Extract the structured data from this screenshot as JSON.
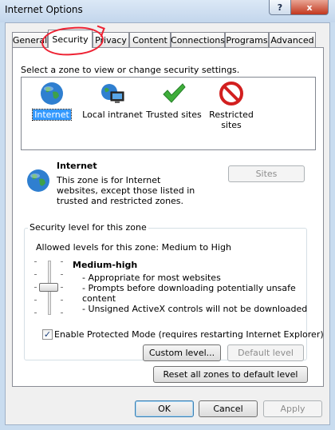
{
  "window": {
    "title": "Internet Options",
    "help_label": "?",
    "close_label": "x"
  },
  "tabs": [
    {
      "label": "General"
    },
    {
      "label": "Security",
      "active": true
    },
    {
      "label": "Privacy"
    },
    {
      "label": "Content"
    },
    {
      "label": "Connections"
    },
    {
      "label": "Programs"
    },
    {
      "label": "Advanced"
    }
  ],
  "zones": {
    "prompt": "Select a zone to view or change security settings.",
    "items": [
      {
        "label": "Internet",
        "icon": "globe-icon",
        "selected": true
      },
      {
        "label": "Local intranet",
        "icon": "intranet-icon"
      },
      {
        "label": "Trusted sites",
        "icon": "checkmark-icon"
      },
      {
        "label": "Restricted sites",
        "icon": "restricted-icon"
      }
    ]
  },
  "zone_info": {
    "name": "Internet",
    "description": "This zone is for Internet websites, except those listed in trusted and restricted zones.",
    "sites_button": "Sites"
  },
  "security_level": {
    "group_title": "Security level for this zone",
    "allowed": "Allowed levels for this zone: Medium to High",
    "level_name": "Medium-high",
    "bullets": [
      "- Appropriate for most websites",
      "- Prompts before downloading potentially unsafe content",
      "- Unsigned ActiveX controls will not be downloaded"
    ],
    "protected_mode_label": "Enable Protected Mode (requires restarting Internet Explorer)",
    "protected_mode_checked": true,
    "custom_level_button": "Custom level...",
    "default_level_button": "Default level"
  },
  "reset_button": "Reset all zones to default level",
  "footer": {
    "ok": "OK",
    "cancel": "Cancel",
    "apply": "Apply"
  }
}
